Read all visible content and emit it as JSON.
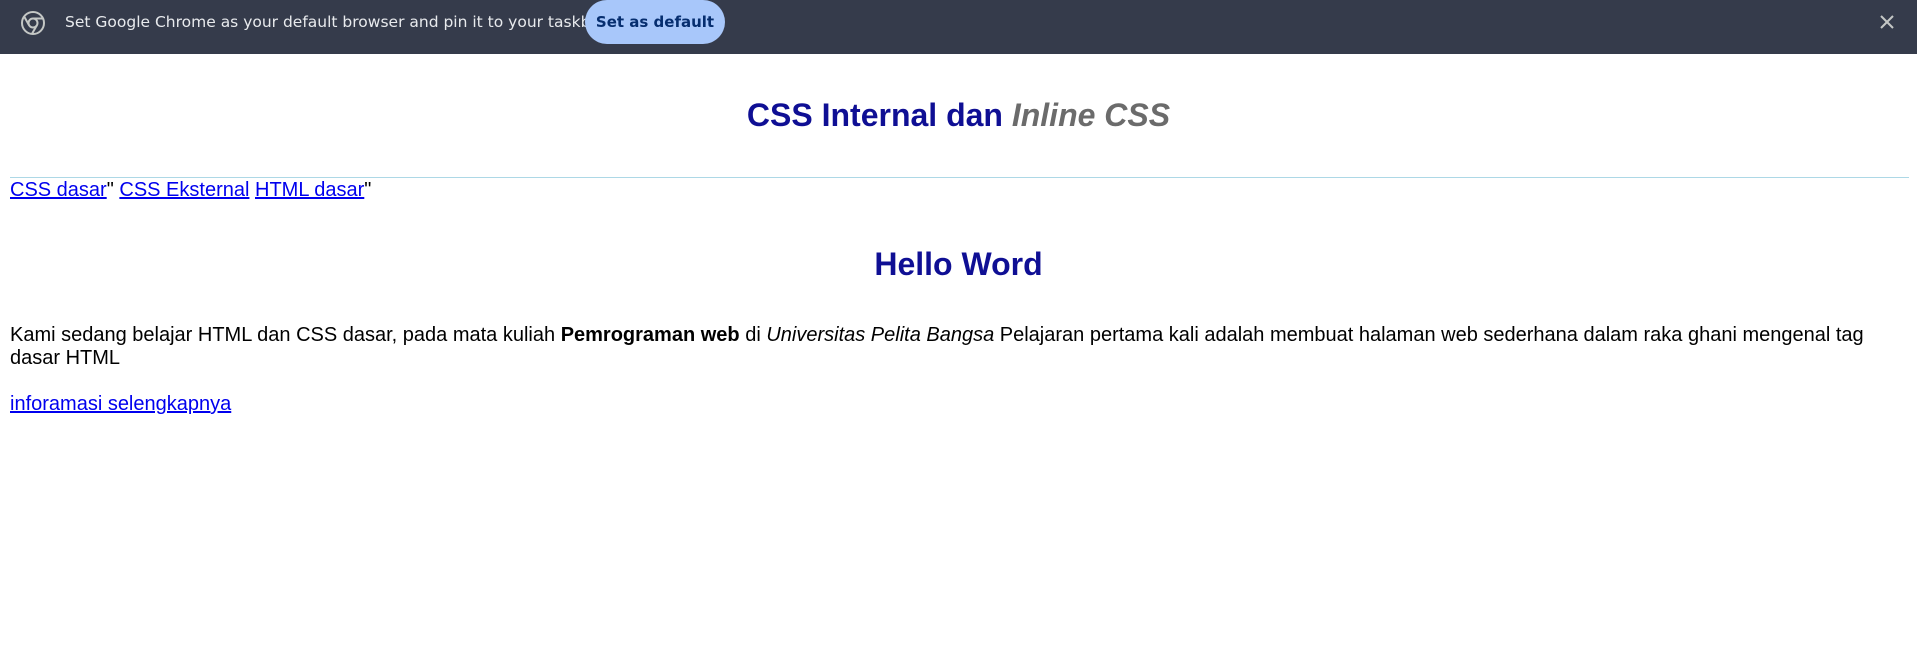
{
  "infobar": {
    "message": "Set Google Chrome as your default browser and pin it to your taskbar",
    "set_default_label": "Set as default",
    "icon": "chrome-icon",
    "close_icon": "close-icon",
    "colors": {
      "background": "#353b4b",
      "button": "#a8c7fa",
      "button_text": "#062e6f"
    }
  },
  "page": {
    "title_main": "CSS Internal dan ",
    "title_accent": "Inline CSS",
    "nav": [
      {
        "label": "CSS dasar",
        "after": "\" "
      },
      {
        "label": "CSS Eksternal",
        "after": " "
      },
      {
        "label": "HTML dasar",
        "after": "\""
      }
    ],
    "heading": "Hello Word",
    "paragraph": {
      "text1": "Kami sedang belajar HTML dan CSS dasar, pada mata kuliah ",
      "bold": "Pemrograman web",
      "text2": " di ",
      "italic": "Universitas Pelita Bangsa",
      "text3": " Pelajaran pertama kali adalah membuat halaman web sederhana dalam raka ghani mengenal tag dasar HTML"
    },
    "more_link": "inforamasi selengkapnya",
    "colors": {
      "heading": "#0f0f94",
      "accent": "#6b6b6b",
      "link": "#0000ee",
      "rule": "#add8e6"
    }
  }
}
